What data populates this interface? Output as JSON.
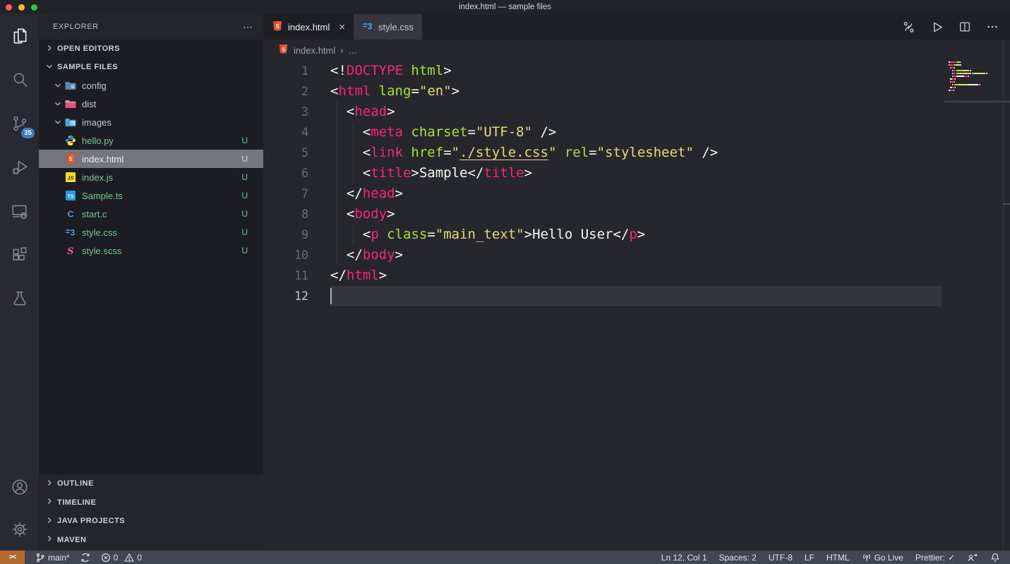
{
  "window": {
    "title": "index.html — sample files"
  },
  "activity_bar": {
    "items": [
      {
        "name": "explorer",
        "icon": "files-icon",
        "active": true
      },
      {
        "name": "search",
        "icon": "search-icon"
      },
      {
        "name": "source-control",
        "icon": "source-control-icon",
        "badge": "35"
      },
      {
        "name": "run-and-debug",
        "icon": "debug-icon"
      },
      {
        "name": "remote-explorer",
        "icon": "remote-explorer-icon"
      },
      {
        "name": "extensions",
        "icon": "extensions-icon"
      },
      {
        "name": "testing",
        "icon": "beaker-icon"
      }
    ],
    "bottom_items": [
      {
        "name": "accounts",
        "icon": "account-icon"
      },
      {
        "name": "settings",
        "icon": "gear-icon"
      }
    ]
  },
  "sidebar": {
    "title": "EXPLORER",
    "more_label": "⋯",
    "sections_top": [
      {
        "label": "OPEN EDITORS",
        "collapsed": true
      },
      {
        "label": "SAMPLE FILES",
        "collapsed": false
      }
    ],
    "tree": [
      {
        "kind": "folder",
        "label": "config",
        "icon": "folder-config",
        "expanded": true
      },
      {
        "kind": "folder",
        "label": "dist",
        "icon": "folder-dist",
        "expanded": true
      },
      {
        "kind": "folder",
        "label": "images",
        "icon": "folder-images",
        "expanded": true
      },
      {
        "kind": "file",
        "label": "hello.py",
        "icon": "python",
        "badge": "U"
      },
      {
        "kind": "file",
        "label": "index.html",
        "icon": "html",
        "badge": "U",
        "selected": true
      },
      {
        "kind": "file",
        "label": "index.js",
        "icon": "js",
        "badge": "U"
      },
      {
        "kind": "file",
        "label": "Sample.ts",
        "icon": "ts",
        "badge": "U"
      },
      {
        "kind": "file",
        "label": "start.c",
        "icon": "c",
        "badge": "U"
      },
      {
        "kind": "file",
        "label": "style.css",
        "icon": "css",
        "badge": "U"
      },
      {
        "kind": "file",
        "label": "style.scss",
        "icon": "scss",
        "badge": "U"
      }
    ],
    "sections_bottom": [
      {
        "label": "OUTLINE"
      },
      {
        "label": "TIMELINE"
      },
      {
        "label": "JAVA PROJECTS"
      },
      {
        "label": "MAVEN"
      }
    ]
  },
  "editor_group": {
    "tabs": [
      {
        "label": "index.html",
        "icon": "html",
        "active": true,
        "close_glyph": "×"
      },
      {
        "label": "style.css",
        "icon": "css",
        "active": false
      }
    ],
    "breadcrumb": {
      "file": "index.html",
      "separator": "›",
      "more": "…"
    }
  },
  "editor": {
    "active_line": 12,
    "cursor_position": {
      "line": 12,
      "col": 1
    },
    "token_colors": {
      "p": "#f8f8f2",
      "t": "#f92672",
      "a": "#a6e22e",
      "s": "#e6db74",
      "u": "#e6db74",
      "x": "#f8f8f2"
    },
    "lines": [
      {
        "n": 1,
        "tokens": [
          [
            "p",
            "<!"
          ],
          [
            "t",
            "DOCTYPE"
          ],
          [
            "p",
            " "
          ],
          [
            "a",
            "html"
          ],
          [
            "p",
            ">"
          ]
        ]
      },
      {
        "n": 2,
        "tokens": [
          [
            "p",
            "<"
          ],
          [
            "t",
            "html"
          ],
          [
            "p",
            " "
          ],
          [
            "a",
            "lang"
          ],
          [
            "p",
            "="
          ],
          [
            "s",
            "\"en\""
          ],
          [
            "p",
            ">"
          ]
        ]
      },
      {
        "n": 3,
        "tokens": [
          [
            "p",
            "  <"
          ],
          [
            "t",
            "head"
          ],
          [
            "p",
            ">"
          ]
        ]
      },
      {
        "n": 4,
        "tokens": [
          [
            "p",
            "    <"
          ],
          [
            "t",
            "meta"
          ],
          [
            "p",
            " "
          ],
          [
            "a",
            "charset"
          ],
          [
            "p",
            "="
          ],
          [
            "s",
            "\"UTF-8\""
          ],
          [
            "p",
            " />"
          ]
        ]
      },
      {
        "n": 5,
        "tokens": [
          [
            "p",
            "    <"
          ],
          [
            "t",
            "link"
          ],
          [
            "p",
            " "
          ],
          [
            "a",
            "href"
          ],
          [
            "p",
            "="
          ],
          [
            "s",
            "\""
          ],
          [
            "u",
            "./style.css"
          ],
          [
            "s",
            "\""
          ],
          [
            "p",
            " "
          ],
          [
            "a",
            "rel"
          ],
          [
            "p",
            "="
          ],
          [
            "s",
            "\"stylesheet\""
          ],
          [
            "p",
            " />"
          ]
        ]
      },
      {
        "n": 6,
        "tokens": [
          [
            "p",
            "    <"
          ],
          [
            "t",
            "title"
          ],
          [
            "p",
            ">"
          ],
          [
            "x",
            "Sample"
          ],
          [
            "p",
            "</"
          ],
          [
            "t",
            "title"
          ],
          [
            "p",
            ">"
          ]
        ]
      },
      {
        "n": 7,
        "tokens": [
          [
            "p",
            "  </"
          ],
          [
            "t",
            "head"
          ],
          [
            "p",
            ">"
          ]
        ]
      },
      {
        "n": 8,
        "tokens": [
          [
            "p",
            "  <"
          ],
          [
            "t",
            "body"
          ],
          [
            "p",
            ">"
          ]
        ]
      },
      {
        "n": 9,
        "tokens": [
          [
            "p",
            "    <"
          ],
          [
            "t",
            "p"
          ],
          [
            "p",
            " "
          ],
          [
            "a",
            "class"
          ],
          [
            "p",
            "="
          ],
          [
            "s",
            "\"main_text\""
          ],
          [
            "p",
            ">"
          ],
          [
            "x",
            "Hello User"
          ],
          [
            "p",
            "</"
          ],
          [
            "t",
            "p"
          ],
          [
            "p",
            ">"
          ]
        ]
      },
      {
        "n": 10,
        "tokens": [
          [
            "p",
            "  </"
          ],
          [
            "t",
            "body"
          ],
          [
            "p",
            ">"
          ]
        ]
      },
      {
        "n": 11,
        "tokens": [
          [
            "p",
            "</"
          ],
          [
            "t",
            "html"
          ],
          [
            "p",
            ">"
          ]
        ]
      },
      {
        "n": 12,
        "tokens": []
      }
    ],
    "indent_guides": [
      {
        "level": 1,
        "from": 3,
        "to": 10
      },
      {
        "level": 2,
        "from": 4,
        "to": 6
      },
      {
        "level": 2,
        "from": 9,
        "to": 9
      }
    ]
  },
  "status_bar": {
    "remote_glyph": "><",
    "branch": "main*",
    "errors": "0",
    "warnings": "0",
    "line_col": "Ln 12, Col 1",
    "indentation": "Spaces: 2",
    "encoding": "UTF-8",
    "eol": "LF",
    "language": "HTML",
    "go_live": "Go Live",
    "prettier": "Prettier:",
    "prettier_check": "✓"
  },
  "colors": {
    "untracked_green": "#73c991",
    "tag_pink": "#f92672",
    "attribute_green": "#a6e22e",
    "string_yellow": "#e6db74",
    "remote_orange": "#b4692e",
    "scm_badge_blue": "#3d7dbd",
    "selected_row_gray": "#74757d"
  }
}
